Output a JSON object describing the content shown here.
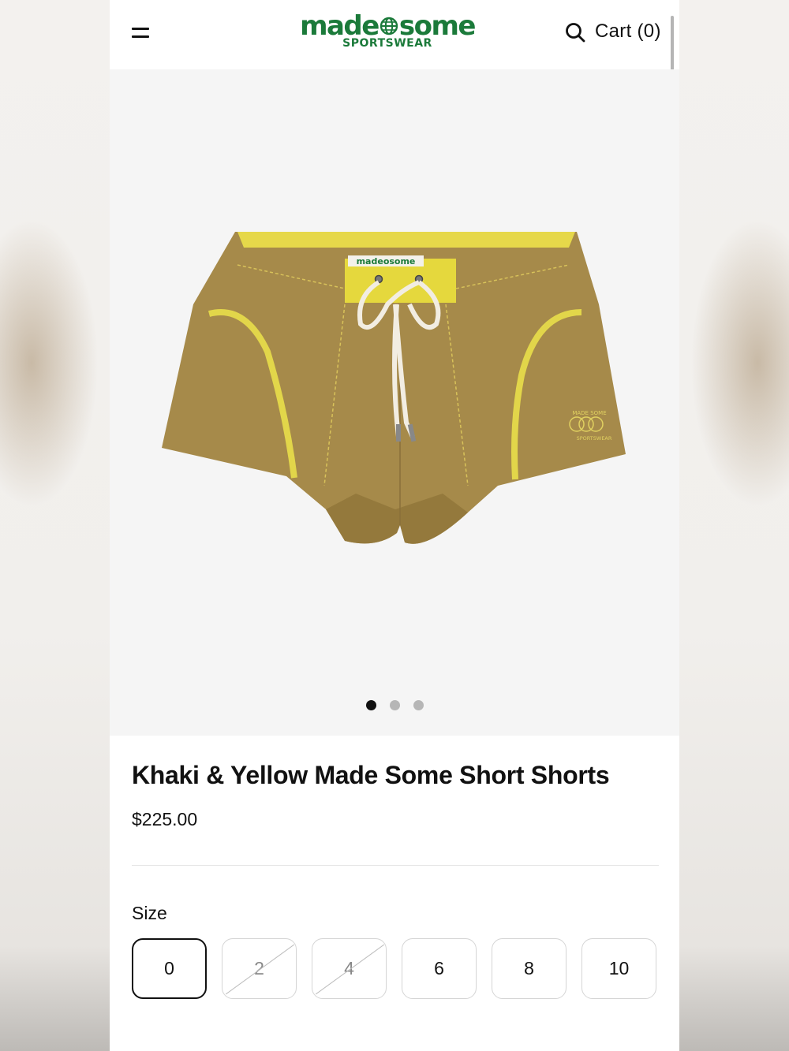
{
  "brand": {
    "logo_left": "made",
    "logo_right": "some",
    "logo_sub": "SPORTSWEAR",
    "color": "#1b7a3a"
  },
  "header": {
    "menu_icon": "menu-icon",
    "search_icon": "search-icon",
    "cart_label": "Cart (0)"
  },
  "gallery": {
    "image": "khaki-yellow-shorts",
    "garment_label": "madeosome",
    "embroidery_top": "MADE SOME",
    "embroidery_bottom": "SPORTSWEAR",
    "slide_count": 3,
    "active_slide": 1
  },
  "product": {
    "title": "Khaki & Yellow Made Some Short Shorts",
    "price": "$225.00"
  },
  "size_selector": {
    "label": "Size",
    "options": [
      {
        "label": "0",
        "state": "selected"
      },
      {
        "label": "2",
        "state": "unavailable"
      },
      {
        "label": "4",
        "state": "unavailable"
      },
      {
        "label": "6",
        "state": "available"
      },
      {
        "label": "8",
        "state": "available"
      },
      {
        "label": "10",
        "state": "available"
      }
    ]
  }
}
